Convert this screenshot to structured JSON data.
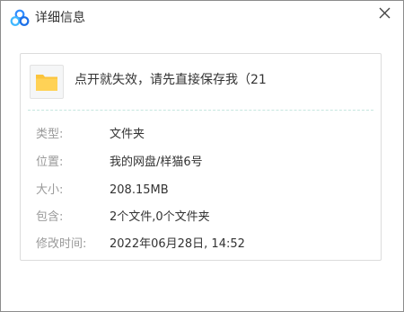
{
  "window": {
    "title": "详细信息",
    "app_icon": "baidu-netdisk-logo-icon",
    "close_icon": "close-icon"
  },
  "file": {
    "icon": "folder-icon",
    "name": "点开就失效，请先直接保存我（21"
  },
  "details": [
    {
      "label": "类型:",
      "value": "文件夹"
    },
    {
      "label": "位置:",
      "value": "我的网盘/样猫6号"
    },
    {
      "label": "大小:",
      "value": "208.15MB"
    },
    {
      "label": "包含:",
      "value": "2个文件,0个文件夹"
    },
    {
      "label": "修改时间:",
      "value": "2022年06月28日, 14:52"
    }
  ],
  "colors": {
    "folder_yellow": "#fbc43c",
    "logo_blue": "#2f8cff",
    "label_gray": "#9a9a9a",
    "divider_teal": "#c5e6df"
  }
}
